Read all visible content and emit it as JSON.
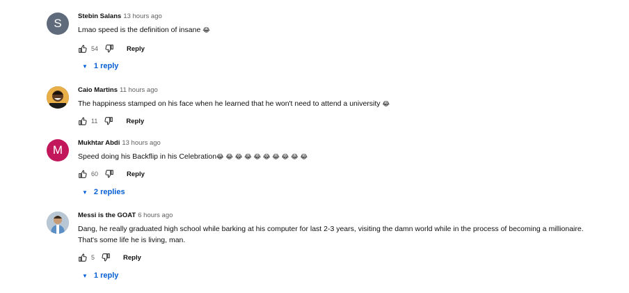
{
  "colors": {
    "reply_link": "#065fd4",
    "muted": "#606060",
    "avatar_s": "#5f6b7a",
    "avatar_m": "#c2185b"
  },
  "comments": [
    {
      "author": "Stebin Salans",
      "time": "13 hours ago",
      "avatar_letter": "S",
      "text": "Lmao speed is the definition of insane",
      "emoji": "😂",
      "likes": "54",
      "reply_label": "Reply",
      "replies": "1 reply"
    },
    {
      "author": "Caio Martins",
      "time": "11 hours ago",
      "avatar_icon": "user-photo-avatar",
      "text": "The happiness stamped on his face when he learned that he won't need to attend a university",
      "emoji": "😂",
      "likes": "11",
      "reply_label": "Reply"
    },
    {
      "author": "Mukhtar Abdi",
      "time": "13 hours ago",
      "avatar_letter": "M",
      "text": "Speed doing his Backflip in his Celebration",
      "emoji": "😂 😂 😂 😂 😂 😂 😂 😂 😂 😂",
      "likes": "60",
      "reply_label": "Reply",
      "replies": "2 replies"
    },
    {
      "author": "Messi is the GOAT",
      "time": "6 hours ago",
      "avatar_icon": "user-photo-avatar",
      "text": "Dang, he really graduated high school while barking at his computer for last 2-3 years, visiting the damn world while in the process of becoming a millionaire.\nThat's some life he is living, man.",
      "likes": "5",
      "reply_label": "Reply",
      "replies": "1 reply"
    }
  ]
}
